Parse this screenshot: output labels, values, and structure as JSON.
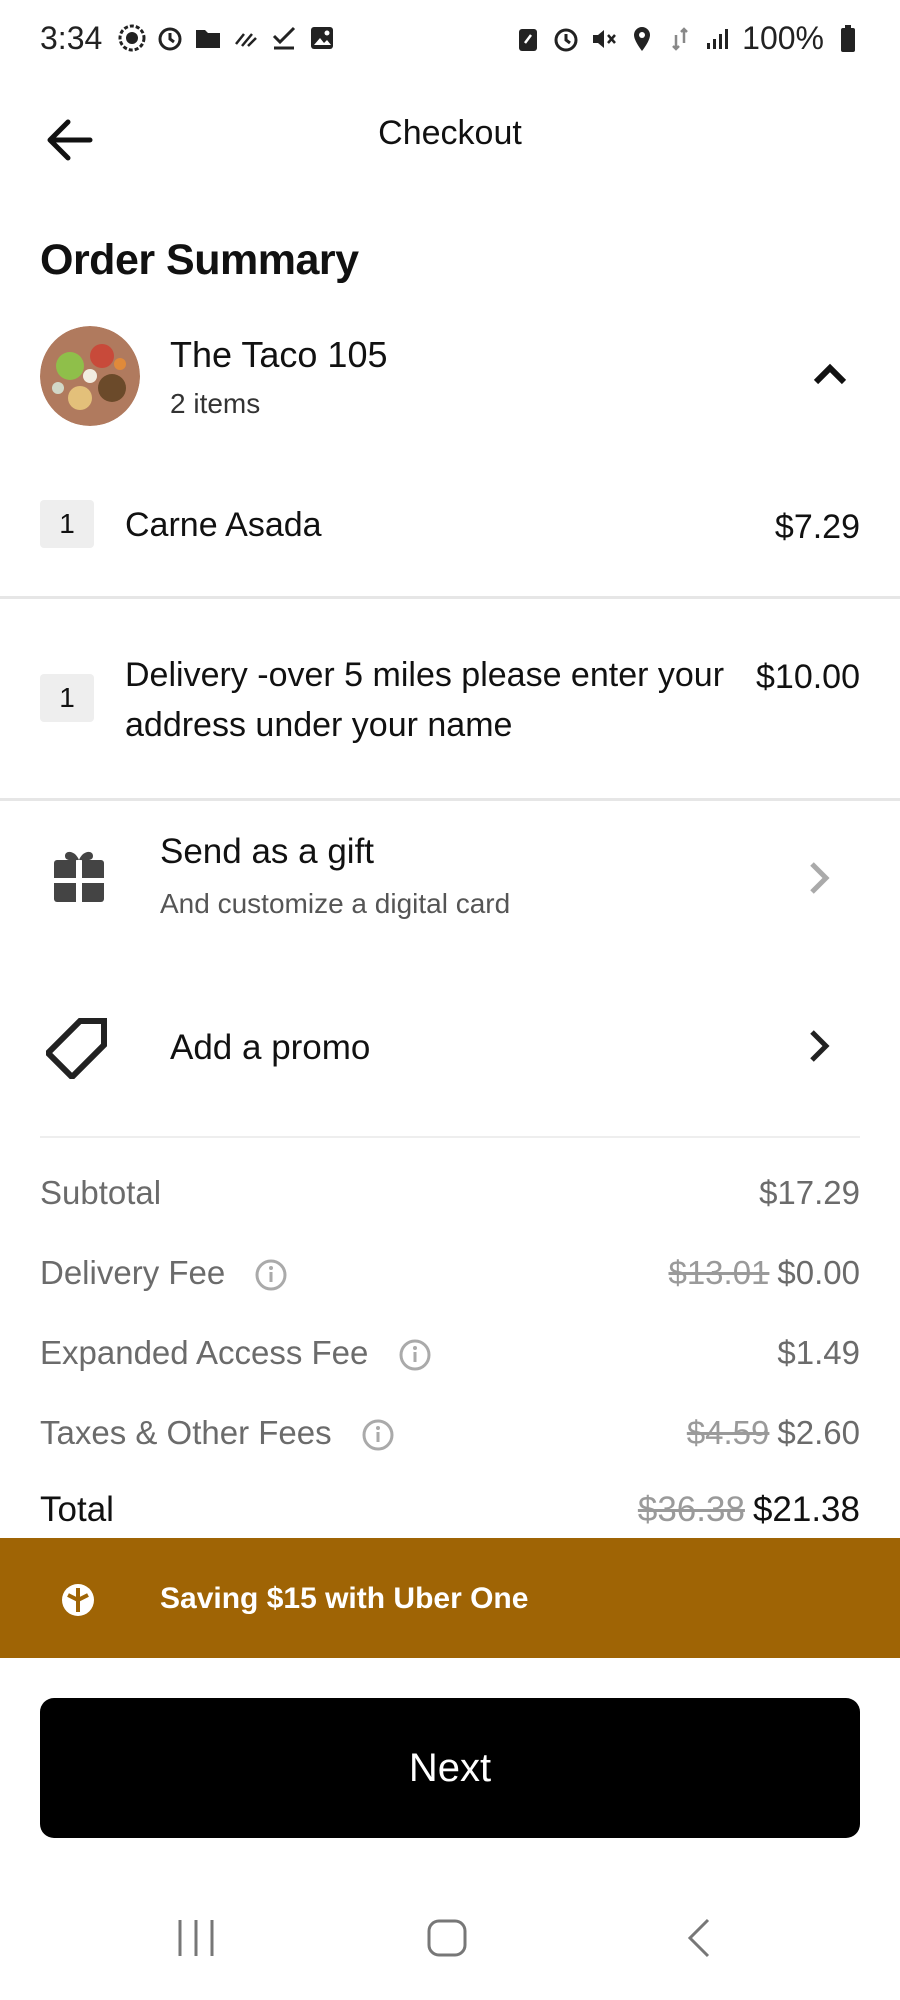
{
  "status_bar": {
    "time": "3:34",
    "battery": "100%",
    "left_icons": [
      "chat-icon",
      "alarm-icon",
      "folder-icon",
      "signal-lines-icon",
      "checkmark-icon",
      "image-icon"
    ],
    "right_icons": [
      "battery-saver-icon",
      "alarm-icon",
      "mute-icon",
      "location-icon",
      "data-icon",
      "signal-icon",
      "battery-icon"
    ]
  },
  "header": {
    "title": "Checkout",
    "back_icon": "arrow-left-icon"
  },
  "order_summary": {
    "title": "Order Summary",
    "store": {
      "name": "The Taco 105",
      "item_count": "2 items"
    },
    "items": [
      {
        "qty": "1",
        "name": "Carne Asada",
        "price": "$7.29"
      },
      {
        "qty": "1",
        "name": "Delivery -over 5 miles please enter your address under your name",
        "price": "$10.00"
      }
    ]
  },
  "gift": {
    "title": "Send as a gift",
    "subtitle": "And customize a digital card"
  },
  "promo": {
    "label": "Add a promo"
  },
  "fees": {
    "subtotal": {
      "label": "Subtotal",
      "value": "$17.29"
    },
    "delivery": {
      "label": "Delivery Fee",
      "original": "$13.01",
      "value": "$0.00"
    },
    "expanded_access": {
      "label": "Expanded Access Fee",
      "value": "$1.49"
    },
    "taxes": {
      "label": "Taxes & Other Fees",
      "original": "$4.59",
      "value": "$2.60"
    },
    "total": {
      "label": "Total",
      "original": "$36.38",
      "value": "$21.38"
    }
  },
  "uber_one": {
    "text": "Saving $15 with Uber One",
    "color": "#9f6405"
  },
  "next_button": {
    "label": "Next"
  }
}
